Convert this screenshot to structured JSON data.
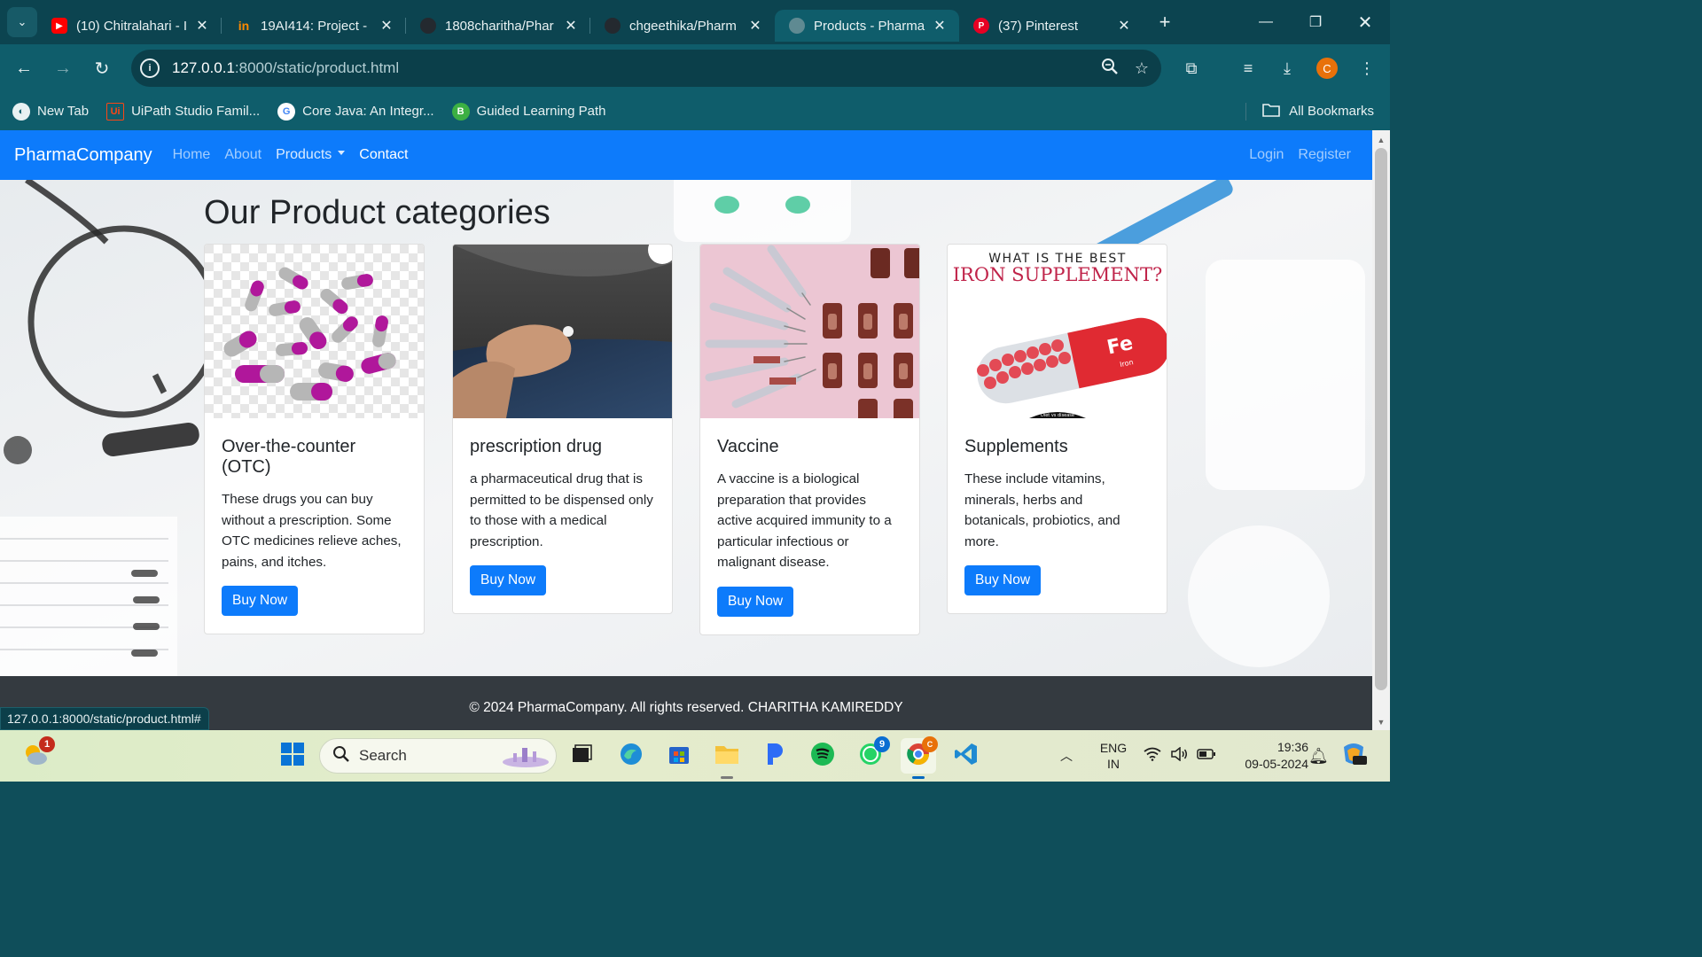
{
  "browser": {
    "tabs": [
      {
        "title": "(10) Chitralahari - I",
        "favicon": "youtube-icon",
        "color": "#ff0000",
        "active": false
      },
      {
        "title": "19AI414: Project -",
        "favicon": "invision-icon",
        "color": "#ff8a00",
        "active": false
      },
      {
        "title": "1808charitha/Phar",
        "favicon": "github-icon",
        "color": "#24292f",
        "active": false
      },
      {
        "title": "chgeethika/Pharm",
        "favicon": "github-icon",
        "color": "#24292f",
        "active": false
      },
      {
        "title": "Products - Pharma",
        "favicon": "globe-icon",
        "color": "#5f8a92",
        "active": true
      },
      {
        "title": "(37) Pinterest",
        "favicon": "pinterest-icon",
        "color": "#e60023",
        "active": false
      }
    ],
    "url_host": "127.0.0.1",
    "url_rest": ":8000/static/product.html",
    "bookmarks": [
      {
        "label": "New Tab",
        "icon": "globe-icon",
        "color": "#e8f1f2"
      },
      {
        "label": "UiPath Studio Famil...",
        "icon": "uipath-icon",
        "color": "#fa4616"
      },
      {
        "label": "Core Java: An Integr...",
        "icon": "google-icon",
        "color": "#ffffff"
      },
      {
        "label": "Guided Learning Path",
        "icon": "b-icon",
        "color": "#3cb043"
      }
    ],
    "all_bookmarks": "All Bookmarks",
    "profile_letter": "C",
    "status_url": "127.0.0.1:8000/static/product.html#"
  },
  "page": {
    "brand": "PharmaCompany",
    "nav": {
      "home": "Home",
      "about": "About",
      "products": "Products",
      "contact": "Contact",
      "login": "Login",
      "register": "Register"
    },
    "heading": "Our Product categories",
    "cards": [
      {
        "title": "Over-the-counter (OTC)",
        "text": "These drugs you can buy without a prescription. Some OTC medicines relieve aches, pains, and itches.",
        "button": "Buy Now",
        "image": "capsules-image"
      },
      {
        "title": "prescription drug",
        "text": "a pharmaceutical drug that is permitted to be dispensed only to those with a medical prescription.",
        "button": "Buy Now",
        "image": "hand-holding-pill-image"
      },
      {
        "title": "Vaccine",
        "text": "A vaccine is a biological preparation that provides active acquired immunity to a particular infectious or malignant disease.",
        "button": "Buy Now",
        "image": "syringes-vials-image"
      },
      {
        "title": "Supplements",
        "text": "These include vitamins, minerals, herbs and botanicals, probiotics, and more.",
        "button": "Buy Now",
        "image": "iron-supplement-image",
        "image_text": {
          "line1": "WHAT IS THE BEST",
          "line2": "IRON SUPPLEMENT?",
          "pill_label": "Fe",
          "pill_sub": "Iron",
          "footer": "Diet vs disease"
        }
      }
    ],
    "footer": "© 2024 PharmaCompany. All rights reserved. CHARITHA KAMIREDDY"
  },
  "taskbar": {
    "search_placeholder": "Search",
    "weather_badge": "1",
    "whatsapp_badge": "9",
    "lang_line1": "ENG",
    "lang_line2": "IN",
    "time": "19:36",
    "date": "09-05-2024"
  },
  "colors": {
    "navbar": "#0d7bfb",
    "button": "#0d7bfb",
    "footer": "#343a40",
    "chrome": "#0f5d6b"
  }
}
